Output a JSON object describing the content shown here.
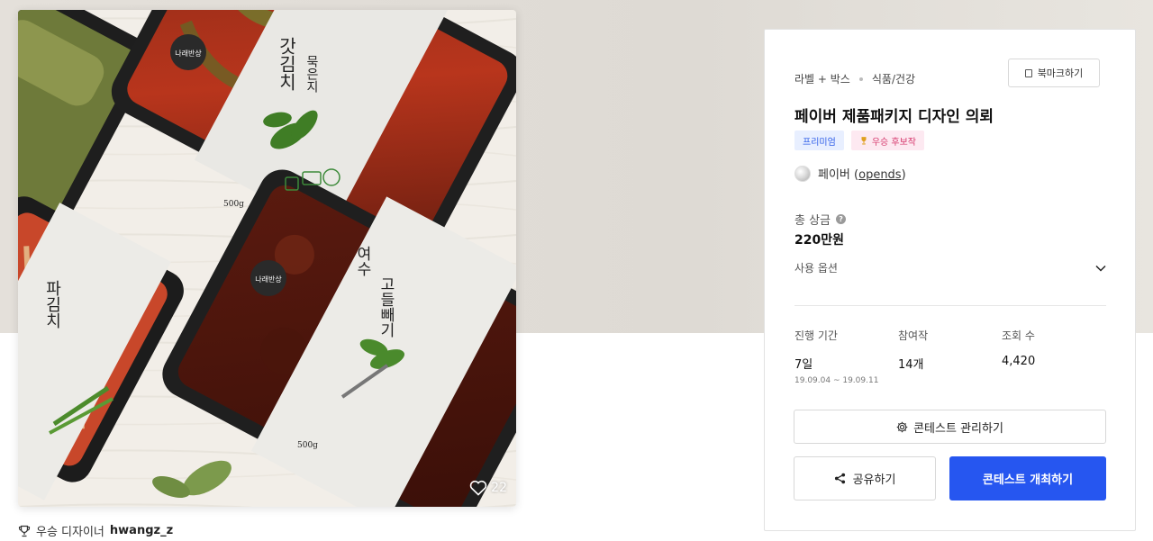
{
  "image": {
    "likes": "22",
    "package_top": {
      "brand": "나래반상",
      "name": "갓김치",
      "sub": "묵은지",
      "weight": "500g"
    },
    "package_bottom": {
      "brand": "나래반상",
      "name1": "여수",
      "name2": "고들빼기",
      "weight": "500g"
    },
    "package_left": {
      "name": "파김치"
    }
  },
  "winner": {
    "label": "우승 디자이너",
    "name": "hwangz_z"
  },
  "panel": {
    "breadcrumb": [
      "라벨 + 박스",
      "식품/건강"
    ],
    "bookmark_label": "북마크하기",
    "title": "페이버 제품패키지 디자인 의뢰",
    "badges": {
      "premium": "프리미엄",
      "winner": "우승 후보작"
    },
    "author_name": "페이버",
    "author_handle": "opends",
    "prize_label": "총 상금",
    "prize_value": "220만원",
    "usage_label": "사용 옵션",
    "stats": [
      {
        "label": "진행 기간",
        "value": "7일",
        "sub": "19.09.04 ~ 19.09.11"
      },
      {
        "label": "참여작",
        "value": "14개"
      },
      {
        "label": "조회 수",
        "value": "4,420"
      }
    ],
    "manage_label": "콘테스트 관리하기",
    "share_label": "공유하기",
    "host_label": "콘테스트 개최하기"
  },
  "colors": {
    "primary": "#2656f0",
    "premium_badge_text": "#2d5de8",
    "winner_badge_text": "#d63a6e",
    "band": "#e4e0da"
  },
  "icons": [
    "heart-icon",
    "trophy-icon",
    "bookmark-icon",
    "help-icon",
    "chevron-down-icon",
    "gear-icon",
    "share-icon"
  ]
}
